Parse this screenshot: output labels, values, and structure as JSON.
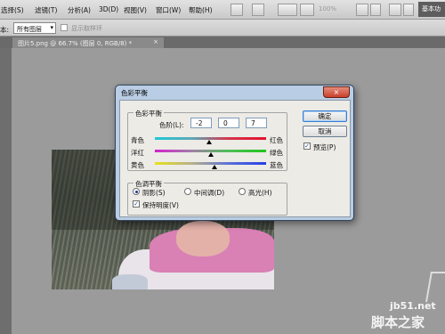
{
  "menubar": {
    "items": [
      "选择(S)",
      "滤镜(T)",
      "分析(A)",
      "3D(D)",
      "视图(V)",
      "窗口(W)",
      "帮助(H)"
    ],
    "zoom": "100%",
    "workspace": "基本功"
  },
  "options": {
    "sample_label": "本:",
    "sample_value": "所有图层",
    "show_ring_label": "显示取样环"
  },
  "document": {
    "tab_title": "图片5.png @ 66.7% (图层 0, RGB/8) *",
    "close": "×"
  },
  "dialog": {
    "title": "色彩平衡",
    "close": "×",
    "balance_group": "色彩平衡",
    "levels_label": "色阶(L):",
    "levels": [
      "-2",
      "0",
      "7"
    ],
    "sliders": [
      {
        "left": "青色",
        "right": "红色",
        "value": -2
      },
      {
        "left": "洋红",
        "right": "绿色",
        "value": 0
      },
      {
        "left": "黄色",
        "right": "蓝色",
        "value": 7
      }
    ],
    "tone_group": "色调平衡",
    "tones": [
      {
        "label": "阴影(S)",
        "selected": true
      },
      {
        "label": "中间调(D)",
        "selected": false
      },
      {
        "label": "高光(H)",
        "selected": false
      }
    ],
    "preserve_label": "保持明度(V)",
    "preserve_checked": true,
    "ok_label": "确定",
    "cancel_label": "取消",
    "preview_label": "预览(P)",
    "preview_checked": true
  },
  "watermark": {
    "url": "jb51.net",
    "site": "脚本之家"
  }
}
